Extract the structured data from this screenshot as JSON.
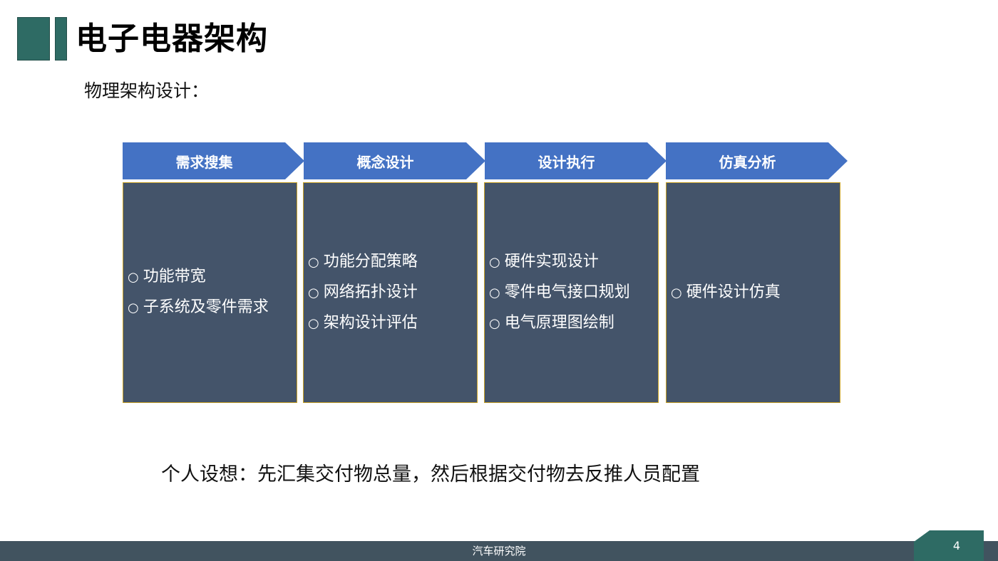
{
  "header": {
    "title": "电子电器架构"
  },
  "subtitle": "物理架构设计：",
  "process": {
    "steps": [
      {
        "label": "需求搜集",
        "items": [
          "功能带宽",
          "子系统及零件需求"
        ]
      },
      {
        "label": "概念设计",
        "items": [
          "功能分配策略",
          "网络拓扑设计",
          "架构设计评估"
        ]
      },
      {
        "label": "设计执行",
        "items": [
          "硬件实现设计",
          "零件电气接口规划",
          "电气原理图绘制"
        ]
      },
      {
        "label": "仿真分析",
        "items": [
          "硬件设计仿真"
        ]
      }
    ],
    "bullet": "○"
  },
  "note": "个人设想：先汇集交付物总量，然后根据交付物去反推人员配置",
  "footer": {
    "text": "汽车研究院",
    "page_number": "4"
  },
  "colors": {
    "accent_green": "#2e6b64",
    "step_blue": "#4472c4",
    "box_slate": "#44546a",
    "box_border": "#c9a227",
    "footer_bg": "#41535f"
  }
}
